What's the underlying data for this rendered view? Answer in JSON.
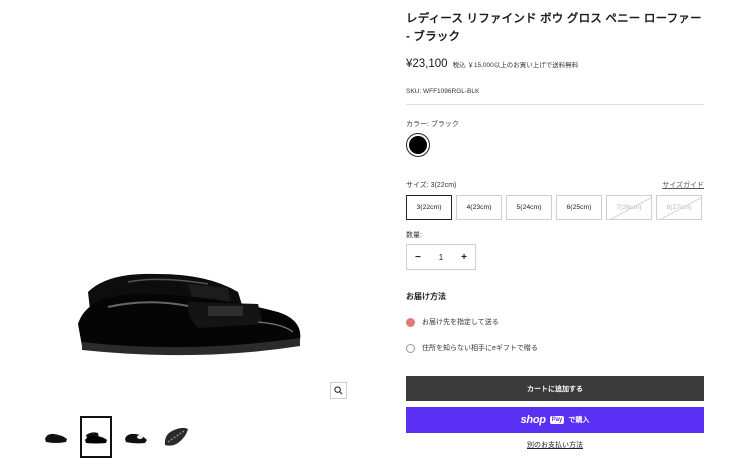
{
  "product": {
    "title": "レディース リファインド ボウ グロス ペニー ローファー - ブラック",
    "price": "¥23,100",
    "price_note": "税込 ￥15,000以上のお買い上げで送料無料",
    "sku": "SKU: WFF1096RGL-BLK"
  },
  "color": {
    "label": "カラー: ブラック",
    "swatch_hex": "#000000"
  },
  "size": {
    "label": "サイズ:  3(22cm)",
    "guide_label": "サイズガイド",
    "options": [
      {
        "label": "3(22cm)",
        "state": "selected"
      },
      {
        "label": "4(23cm)",
        "state": "available"
      },
      {
        "label": "5(24cm)",
        "state": "available"
      },
      {
        "label": "6(25cm)",
        "state": "available"
      },
      {
        "label": "7(26cm)",
        "state": "disabled"
      },
      {
        "label": "8(27cm)",
        "state": "disabled"
      }
    ]
  },
  "quantity": {
    "label": "数量:",
    "value": "1",
    "minus": "−",
    "plus": "+"
  },
  "delivery": {
    "title": "お届け方法",
    "option_1": "お届け先を指定して送る",
    "option_2": "住所を知らない相手にeギフトで贈る"
  },
  "actions": {
    "add_to_cart": "カートに追加する",
    "shop_logo": "shop",
    "pay_badge": "Pay",
    "buy_label": "で購入",
    "other_payment": "別のお支払い方法"
  },
  "gallery": {
    "thumbnail_count": 4,
    "active_thumbnail": 2
  },
  "colors": {
    "add_to_cart_bg": "#3a3a3a",
    "shop_pay_bg": "#5a31f4",
    "radio_checked": "#e07a7a"
  }
}
